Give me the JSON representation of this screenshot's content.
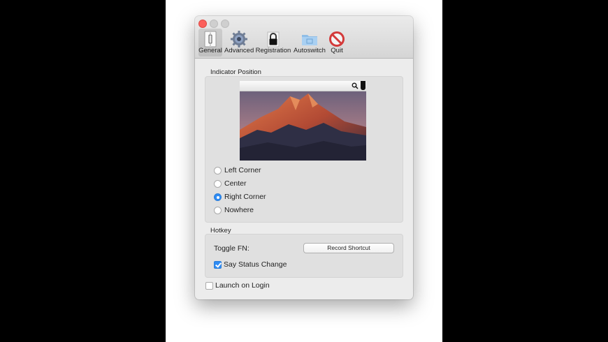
{
  "toolbar": {
    "items": [
      {
        "label": "General",
        "icon": "light-switch-icon",
        "selected": true
      },
      {
        "label": "Advanced",
        "icon": "gear-icon",
        "selected": false
      },
      {
        "label": "Registration",
        "icon": "padlock-icon",
        "selected": false
      },
      {
        "label": "Autoswitch",
        "icon": "folder-icon",
        "selected": false
      },
      {
        "label": "Quit",
        "icon": "no-sign-icon",
        "selected": false
      }
    ]
  },
  "indicator": {
    "section_title": "Indicator Position",
    "options": [
      {
        "label": "Left Corner",
        "selected": false
      },
      {
        "label": "Center",
        "selected": false
      },
      {
        "label": "Right Corner",
        "selected": true
      },
      {
        "label": "Nowhere",
        "selected": false
      }
    ]
  },
  "hotkey": {
    "section_title": "Hotkey",
    "toggle_label": "Toggle FN:",
    "record_button": "Record Shortcut",
    "say_status_label": "Say Status Change",
    "say_status_checked": true
  },
  "launch_on_login": {
    "label": "Launch on Login",
    "checked": false
  },
  "colors": {
    "accent": "#2f8cf4",
    "close": "#fc605c"
  }
}
